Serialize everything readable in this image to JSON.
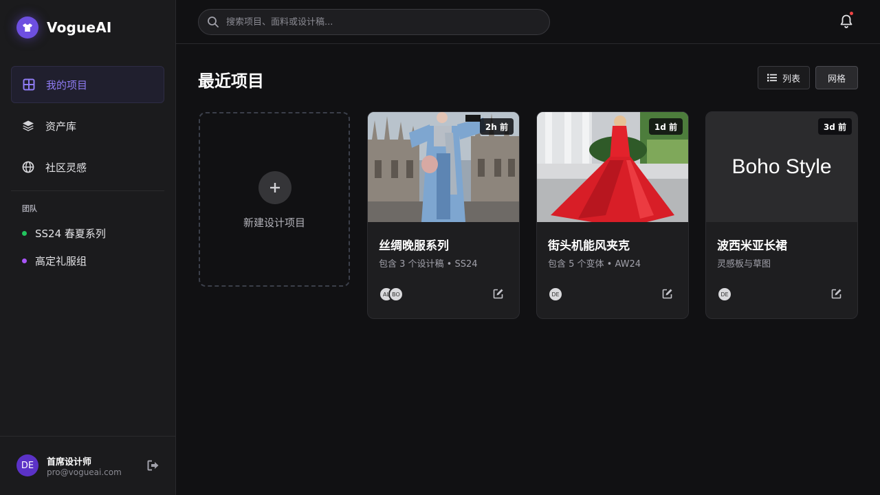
{
  "brand": {
    "name": "VogueAI"
  },
  "sidebar": {
    "nav": [
      {
        "label": "我的项目",
        "icon": "grid-icon",
        "active": true
      },
      {
        "label": "资产库",
        "icon": "layers-icon"
      },
      {
        "label": "社区灵感",
        "icon": "globe-icon"
      }
    ],
    "team_heading": "团队",
    "teams": [
      {
        "label": "SS24 春夏系列",
        "color": "#22c55e"
      },
      {
        "label": "高定礼服组",
        "color": "#a855f7"
      }
    ],
    "user": {
      "initials": "DE",
      "name": "首席设计师",
      "email": "pro@vogueai.com"
    }
  },
  "search": {
    "placeholder": "搜索项目、面料或设计稿..."
  },
  "main": {
    "title": "最近项目",
    "view_list_label": "列表",
    "view_grid_label": "网格",
    "new_project_label": "新建设计项目",
    "projects": [
      {
        "title": "丝绸晚服系列",
        "subtitle": "包含 3 个设计稿 • SS24",
        "time": "2h 前",
        "avatars": [
          "AL",
          "BO"
        ]
      },
      {
        "title": "街头机能风夹克",
        "subtitle": "包含 5 个变体 • AW24",
        "time": "1d 前",
        "avatars": [
          "DE"
        ]
      },
      {
        "title": "波西米亚长裙",
        "subtitle": "灵感板与草图",
        "time": "3d 前",
        "avatars": [
          "DE"
        ],
        "cover_text": "Boho Style"
      }
    ]
  }
}
